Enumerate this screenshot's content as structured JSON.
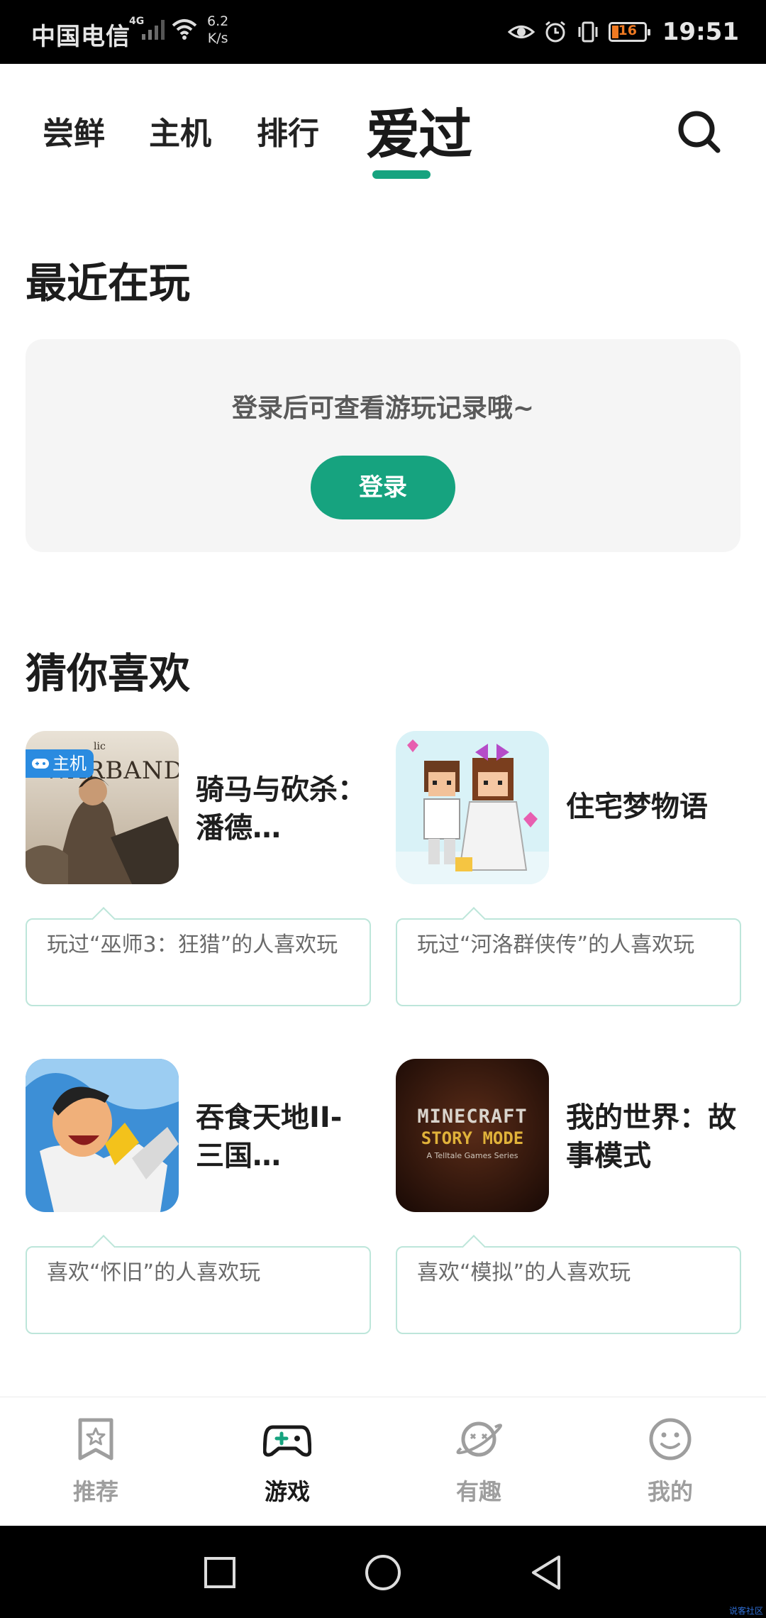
{
  "status_bar": {
    "carrier": "中国电信",
    "network": "4G",
    "speed_value": "6.2",
    "speed_unit": "K/s",
    "battery": "16",
    "time": "19:51"
  },
  "top_tabs": [
    {
      "label": "尝鲜"
    },
    {
      "label": "主机"
    },
    {
      "label": "排行"
    },
    {
      "label": "爱过",
      "active": true
    }
  ],
  "recent": {
    "title": "最近在玩",
    "message": "登录后可查看游玩记录哦~",
    "login_label": "登录"
  },
  "recommend": {
    "title": "猜你喜欢",
    "games": [
      {
        "title": "骑马与砍杀：潘德…",
        "badge": "主机",
        "reason": "玩过“巫师3：狂猎”的人喜欢玩",
        "icon_text": "WARBAND",
        "icon_note": "lic"
      },
      {
        "title": "住宅梦物语",
        "reason": "玩过“河洛群侠传”的人喜欢玩"
      },
      {
        "title": "吞食天地II-三国…",
        "reason": "喜欢“怀旧”的人喜欢玩"
      },
      {
        "title": "我的世界：故事模式",
        "reason": "喜欢“模拟”的人喜欢玩",
        "icon_text": "MINECRAFT",
        "icon_text2": "STORY MODE",
        "icon_text3": "A Telltale Games Series"
      }
    ]
  },
  "bottom_nav": [
    {
      "label": "推荐",
      "icon": "bookmark-star-icon"
    },
    {
      "label": "游戏",
      "icon": "gamepad-icon",
      "active": true
    },
    {
      "label": "有趣",
      "icon": "planet-icon"
    },
    {
      "label": "我的",
      "icon": "smiley-icon"
    }
  ],
  "watermark": "说客社区",
  "colors": {
    "accent": "#16a37f",
    "badge": "#2a8be0"
  }
}
